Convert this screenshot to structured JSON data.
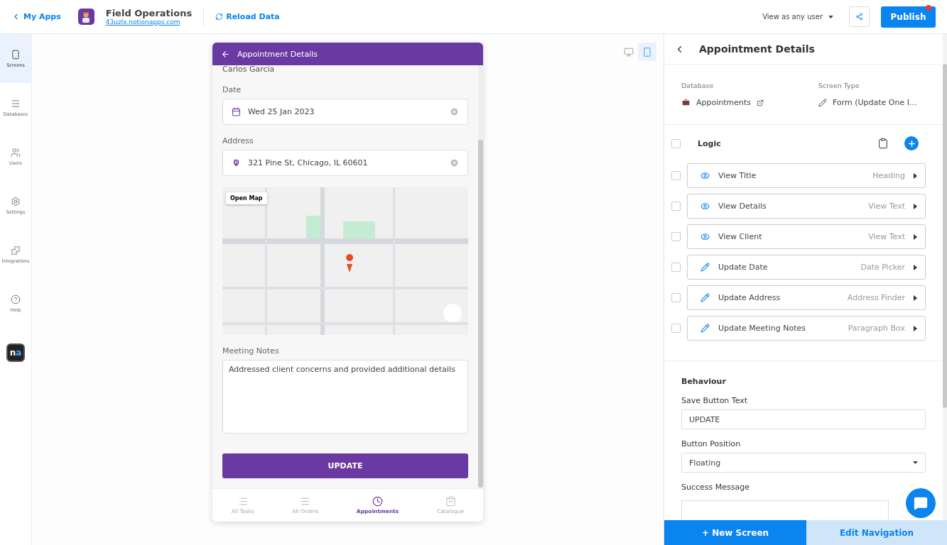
{
  "topbar": {
    "back_link": "My Apps",
    "app_name": "Field Operations",
    "app_url": "43uzlx.notionapps.com",
    "reload": "Reload Data",
    "view_as": "View as any user",
    "publish": "Publish",
    "publish_notification": true
  },
  "sidebar": {
    "items": [
      {
        "label": "Screens",
        "kind": "screens",
        "selected": true
      },
      {
        "label": "Databases",
        "kind": "databases",
        "selected": false
      },
      {
        "label": "Users",
        "kind": "users",
        "selected": false
      },
      {
        "label": "Settings",
        "kind": "settings",
        "selected": false
      },
      {
        "label": "Integrations",
        "kind": "integrations",
        "selected": false
      },
      {
        "label": "Help",
        "kind": "help",
        "selected": false
      }
    ],
    "logo": {
      "first": "n",
      "second": "a"
    }
  },
  "device_toggle": [
    {
      "kind": "desktop",
      "selected": false
    },
    {
      "kind": "mobile",
      "selected": true
    }
  ],
  "phone": {
    "title": "Appointment Details",
    "client": "Carlos Garcia",
    "fields": [
      {
        "kind": "date",
        "label": "Date",
        "value": "Wed 25 Jan 2023"
      },
      {
        "kind": "address",
        "label": "Address",
        "value": "321 Pine St, Chicago, IL 60601"
      }
    ],
    "map": {
      "open_button": "Open Map"
    },
    "notes": {
      "label": "Meeting Notes",
      "value": "Addressed client concerns and provided additional details"
    },
    "submit": "UPDATE",
    "nav": [
      {
        "label": "All Tasks",
        "kind": "tasks",
        "selected": false
      },
      {
        "label": "All Orders",
        "kind": "orders",
        "selected": false
      },
      {
        "label": "Appointments",
        "kind": "clock",
        "selected": true
      },
      {
        "label": "Catalogue",
        "kind": "bag",
        "selected": false
      }
    ]
  },
  "panel": {
    "title": "Appointment Details",
    "database_label": "Database",
    "database": "Appointments",
    "screen_type_label": "Screen Type",
    "screen_type": "Form (Update One I...",
    "logic": {
      "label": "Logic",
      "checked": false
    },
    "components": [
      {
        "kind": "view",
        "name": "View Title",
        "type": "Heading",
        "checked": false
      },
      {
        "kind": "view",
        "name": "View Details",
        "type": "View Text",
        "checked": false
      },
      {
        "kind": "view",
        "name": "View Client",
        "type": "View Text",
        "checked": false
      },
      {
        "kind": "update",
        "name": "Update Date",
        "type": "Date Picker",
        "checked": false
      },
      {
        "kind": "update",
        "name": "Update Address",
        "type": "Address Finder",
        "checked": false
      },
      {
        "kind": "update",
        "name": "Update Meeting Notes",
        "type": "Paragraph Box",
        "checked": false
      }
    ],
    "behaviour": {
      "heading": "Behaviour",
      "save_label": "Save Button Text",
      "save_value": "UPDATE",
      "position_label": "Button Position",
      "position_value": "Floating",
      "success_label": "Success Message"
    },
    "new_screen": "+ New Screen",
    "edit_navigation": "Edit Navigation"
  }
}
